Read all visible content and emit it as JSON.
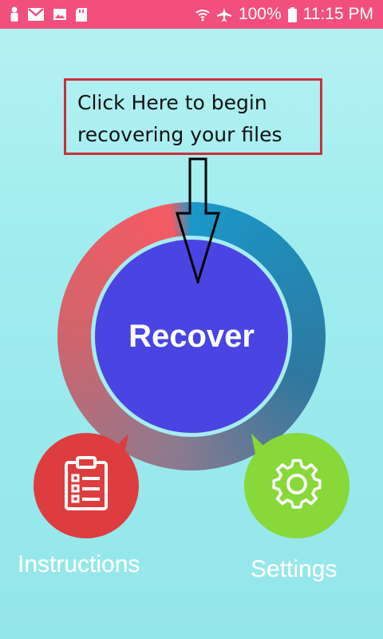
{
  "status_bar": {
    "battery": "100%",
    "time": "11:15 PM",
    "left_icons": [
      "person-icon",
      "gmail-icon",
      "image-icon",
      "sd-card-icon"
    ],
    "right_icons": [
      "wifi-icon",
      "airplane-icon",
      "battery-icon"
    ]
  },
  "callout": {
    "line1": "Click Here to begin",
    "line2": "recovering your files"
  },
  "main": {
    "recover_label": "Recover"
  },
  "actions": {
    "instructions_label": "Instructions",
    "settings_label": "Settings"
  },
  "colors": {
    "status_bar": "#f24f7c",
    "recover": "#4a44e2",
    "instructions": "#dd3d3f",
    "settings": "#87d838"
  }
}
